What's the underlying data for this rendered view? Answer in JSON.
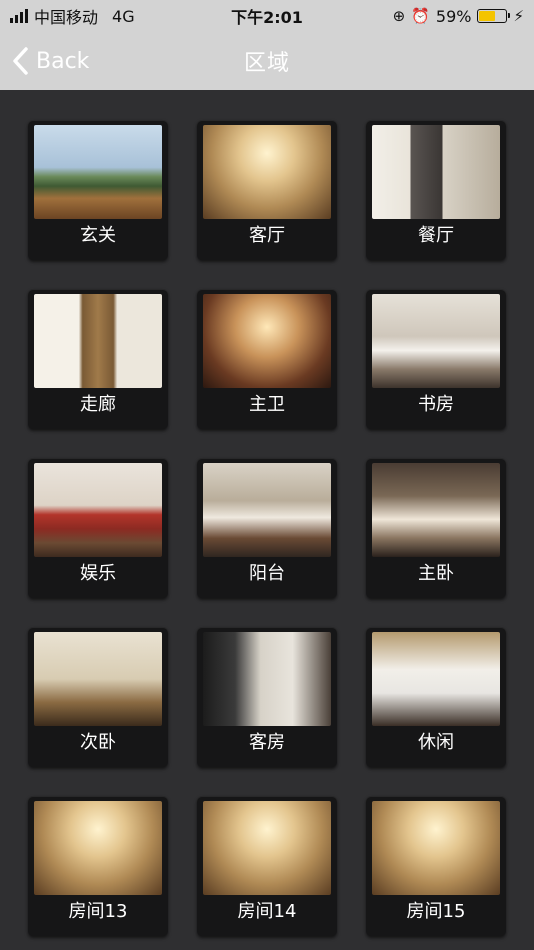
{
  "status_bar": {
    "carrier": "中国移动",
    "network": "4G",
    "time": "下午2:01",
    "battery_percent": "59%",
    "battery_level": 0.59,
    "battery_color": "#f4c400",
    "icons": [
      "signal-icon",
      "rotation-lock-icon",
      "alarm-icon",
      "battery-icon",
      "charging-bolt-icon"
    ]
  },
  "nav": {
    "back_label": "Back",
    "title": "区域",
    "back_icon": "chevron-left-icon"
  },
  "areas": [
    {
      "label": "玄关",
      "image": "balcony-view-photo"
    },
    {
      "label": "客厅",
      "image": "living-room-photo"
    },
    {
      "label": "餐厅",
      "image": "dining-room-photo"
    },
    {
      "label": "走廊",
      "image": "corridor-photo"
    },
    {
      "label": "主卫",
      "image": "master-bath-photo"
    },
    {
      "label": "书房",
      "image": "study-photo"
    },
    {
      "label": "娱乐",
      "image": "entertainment-room-photo"
    },
    {
      "label": "阳台",
      "image": "balcony-photo"
    },
    {
      "label": "主卧",
      "image": "master-bedroom-photo"
    },
    {
      "label": "次卧",
      "image": "second-bedroom-photo"
    },
    {
      "label": "客房",
      "image": "guest-room-photo"
    },
    {
      "label": "休闲",
      "image": "leisure-room-photo"
    },
    {
      "label": "房间13",
      "image": "living-room-photo"
    },
    {
      "label": "房间14",
      "image": "living-room-photo"
    },
    {
      "label": "房间15",
      "image": "living-room-photo"
    }
  ]
}
